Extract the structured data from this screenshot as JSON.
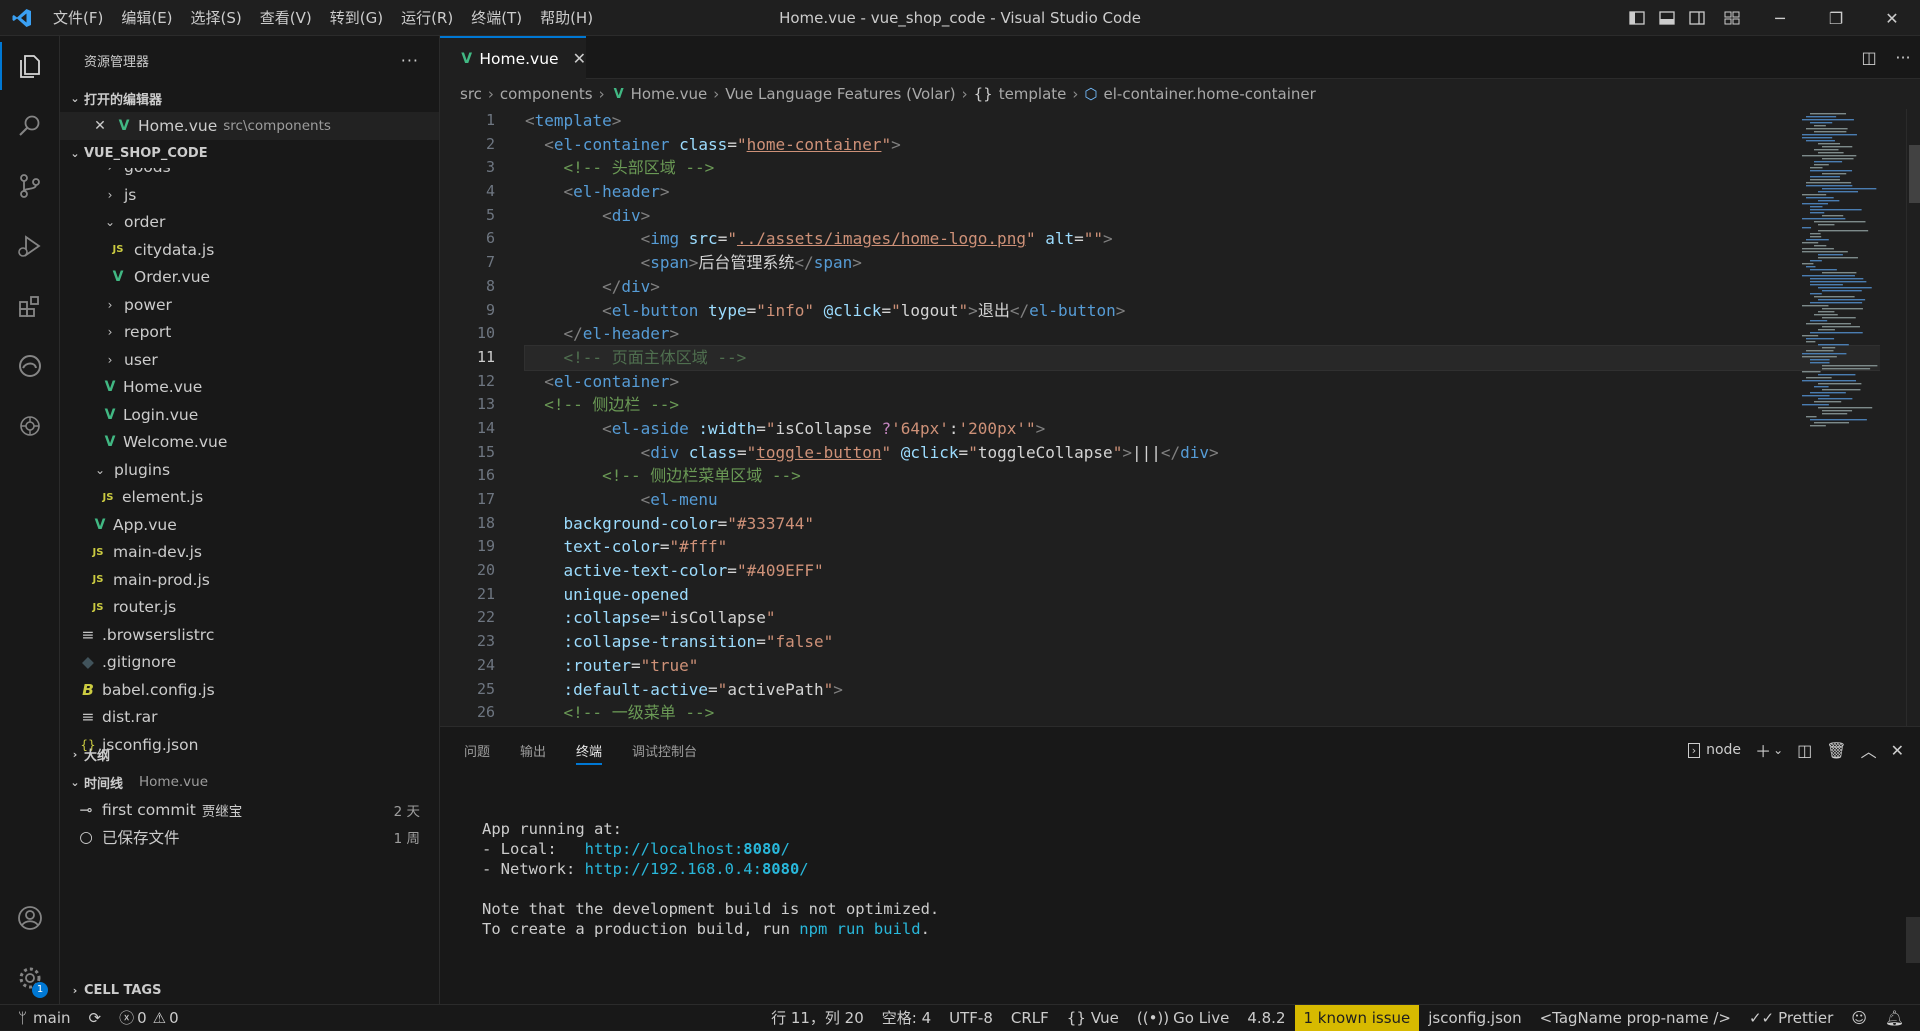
{
  "titlebar": {
    "title": "Home.vue - vue_shop_code - Visual Studio Code",
    "menus": [
      "文件(F)",
      "编辑(E)",
      "选择(S)",
      "查看(V)",
      "转到(G)",
      "运行(R)",
      "终端(T)",
      "帮助(H)"
    ]
  },
  "sidebar": {
    "header": "资源管理器",
    "more": "···",
    "open_editors": "打开的编辑器",
    "open_file": {
      "name": "Home.vue",
      "path": "src\\components"
    },
    "project": "VUE_SHOP_CODE",
    "tree": [
      {
        "name": "goods",
        "type": "folder",
        "open": false
      },
      {
        "name": "js",
        "type": "folder",
        "open": false
      },
      {
        "name": "order",
        "type": "folder",
        "open": true
      },
      {
        "name": "citydata.js",
        "type": "js"
      },
      {
        "name": "Order.vue",
        "type": "vue"
      },
      {
        "name": "power",
        "type": "folder",
        "open": false
      },
      {
        "name": "report",
        "type": "folder",
        "open": false
      },
      {
        "name": "user",
        "type": "folder",
        "open": false
      },
      {
        "name": "Home.vue",
        "type": "vue"
      },
      {
        "name": "Login.vue",
        "type": "vue"
      },
      {
        "name": "Welcome.vue",
        "type": "vue"
      },
      {
        "name": "plugins",
        "type": "folder",
        "open": true
      },
      {
        "name": "element.js",
        "type": "js"
      },
      {
        "name": "App.vue",
        "type": "vue"
      },
      {
        "name": "main-dev.js",
        "type": "js"
      },
      {
        "name": "main-prod.js",
        "type": "js"
      },
      {
        "name": "router.js",
        "type": "js"
      },
      {
        "name": ".browserslistrc",
        "type": "text"
      },
      {
        "name": ".gitignore",
        "type": "git"
      },
      {
        "name": "babel.config.js",
        "type": "babel"
      },
      {
        "name": "dist.rar",
        "type": "text"
      },
      {
        "name": "jsconfig.json",
        "type": "json"
      }
    ],
    "outline": "大纲",
    "timeline": "时间线",
    "timeline_file": "Home.vue",
    "timeline_items": [
      {
        "label": "first commit",
        "author": "贾继宝",
        "time": "2 天"
      },
      {
        "label": "已保存文件",
        "author": "",
        "time": "1 周"
      }
    ],
    "cell_tags": "CELL TAGS"
  },
  "editor": {
    "tab": "Home.vue",
    "breadcrumb": [
      "src",
      "components",
      "Home.vue",
      "Vue Language Features (Volar)",
      "template",
      "el-container.home-container"
    ],
    "line_numbers": [
      "1",
      "2",
      "3",
      "4",
      "5",
      "6",
      "7",
      "8",
      "9",
      "10",
      "11",
      "12",
      "13",
      "14",
      "15",
      "16",
      "17",
      "18",
      "19",
      "20",
      "21",
      "22",
      "23",
      "24",
      "25",
      "26"
    ],
    "current_line": "11"
  },
  "panel": {
    "tabs": [
      "问题",
      "输出",
      "终端",
      "调试控制台"
    ],
    "active_tab": "终端",
    "shell": "node",
    "terminal": {
      "line1": "App running at:",
      "local_label": "- Local:   ",
      "local_url": "http://localhost:",
      "local_port": "8080",
      "network_label": "- Network: ",
      "network_url": "http://192.168.0.4:",
      "network_port": "8080",
      "note1": "Note that the development build is not optimized.",
      "note2_pre": "To create a production build, run ",
      "note2_cmd": "npm run build",
      "note2_post": "."
    }
  },
  "statusbar": {
    "branch": "main",
    "errors": "0",
    "warnings": "0",
    "position": "行 11，列 20",
    "spaces": "空格: 4",
    "encoding": "UTF-8",
    "eol": "CRLF",
    "language": "Vue",
    "golive": "Go Live",
    "version": "4.8.2",
    "issue": "1 known issue",
    "config": "jsconfig.json",
    "tagname": "<TagName prop-name />",
    "prettier": "Prettier"
  },
  "colors": {
    "accent": "#0078d4",
    "vue": "#41b883",
    "js": "#cbcb41",
    "warning": "#d7ba00"
  }
}
